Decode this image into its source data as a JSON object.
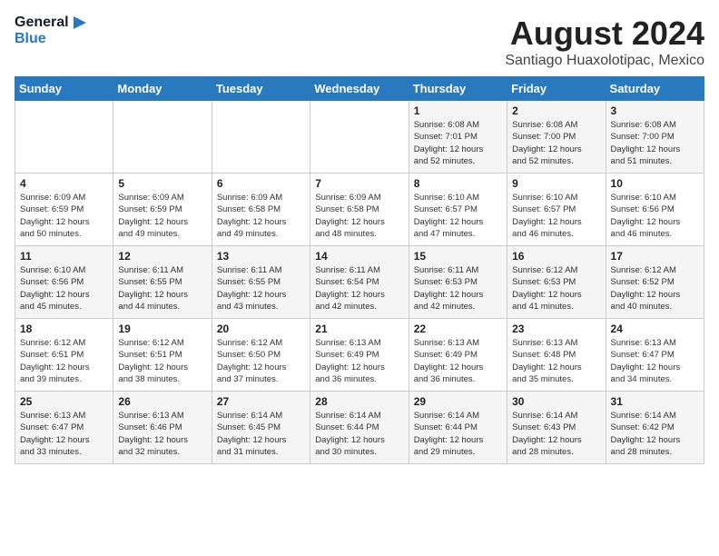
{
  "header": {
    "logo_line1": "General",
    "logo_line2": "Blue",
    "month": "August 2024",
    "location": "Santiago Huaxolotipac, Mexico"
  },
  "weekdays": [
    "Sunday",
    "Monday",
    "Tuesday",
    "Wednesday",
    "Thursday",
    "Friday",
    "Saturday"
  ],
  "weeks": [
    [
      {
        "day": "",
        "info": ""
      },
      {
        "day": "",
        "info": ""
      },
      {
        "day": "",
        "info": ""
      },
      {
        "day": "",
        "info": ""
      },
      {
        "day": "1",
        "info": "Sunrise: 6:08 AM\nSunset: 7:01 PM\nDaylight: 12 hours\nand 52 minutes."
      },
      {
        "day": "2",
        "info": "Sunrise: 6:08 AM\nSunset: 7:00 PM\nDaylight: 12 hours\nand 52 minutes."
      },
      {
        "day": "3",
        "info": "Sunrise: 6:08 AM\nSunset: 7:00 PM\nDaylight: 12 hours\nand 51 minutes."
      }
    ],
    [
      {
        "day": "4",
        "info": "Sunrise: 6:09 AM\nSunset: 6:59 PM\nDaylight: 12 hours\nand 50 minutes."
      },
      {
        "day": "5",
        "info": "Sunrise: 6:09 AM\nSunset: 6:59 PM\nDaylight: 12 hours\nand 49 minutes."
      },
      {
        "day": "6",
        "info": "Sunrise: 6:09 AM\nSunset: 6:58 PM\nDaylight: 12 hours\nand 49 minutes."
      },
      {
        "day": "7",
        "info": "Sunrise: 6:09 AM\nSunset: 6:58 PM\nDaylight: 12 hours\nand 48 minutes."
      },
      {
        "day": "8",
        "info": "Sunrise: 6:10 AM\nSunset: 6:57 PM\nDaylight: 12 hours\nand 47 minutes."
      },
      {
        "day": "9",
        "info": "Sunrise: 6:10 AM\nSunset: 6:57 PM\nDaylight: 12 hours\nand 46 minutes."
      },
      {
        "day": "10",
        "info": "Sunrise: 6:10 AM\nSunset: 6:56 PM\nDaylight: 12 hours\nand 46 minutes."
      }
    ],
    [
      {
        "day": "11",
        "info": "Sunrise: 6:10 AM\nSunset: 6:56 PM\nDaylight: 12 hours\nand 45 minutes."
      },
      {
        "day": "12",
        "info": "Sunrise: 6:11 AM\nSunset: 6:55 PM\nDaylight: 12 hours\nand 44 minutes."
      },
      {
        "day": "13",
        "info": "Sunrise: 6:11 AM\nSunset: 6:55 PM\nDaylight: 12 hours\nand 43 minutes."
      },
      {
        "day": "14",
        "info": "Sunrise: 6:11 AM\nSunset: 6:54 PM\nDaylight: 12 hours\nand 42 minutes."
      },
      {
        "day": "15",
        "info": "Sunrise: 6:11 AM\nSunset: 6:53 PM\nDaylight: 12 hours\nand 42 minutes."
      },
      {
        "day": "16",
        "info": "Sunrise: 6:12 AM\nSunset: 6:53 PM\nDaylight: 12 hours\nand 41 minutes."
      },
      {
        "day": "17",
        "info": "Sunrise: 6:12 AM\nSunset: 6:52 PM\nDaylight: 12 hours\nand 40 minutes."
      }
    ],
    [
      {
        "day": "18",
        "info": "Sunrise: 6:12 AM\nSunset: 6:51 PM\nDaylight: 12 hours\nand 39 minutes."
      },
      {
        "day": "19",
        "info": "Sunrise: 6:12 AM\nSunset: 6:51 PM\nDaylight: 12 hours\nand 38 minutes."
      },
      {
        "day": "20",
        "info": "Sunrise: 6:12 AM\nSunset: 6:50 PM\nDaylight: 12 hours\nand 37 minutes."
      },
      {
        "day": "21",
        "info": "Sunrise: 6:13 AM\nSunset: 6:49 PM\nDaylight: 12 hours\nand 36 minutes."
      },
      {
        "day": "22",
        "info": "Sunrise: 6:13 AM\nSunset: 6:49 PM\nDaylight: 12 hours\nand 36 minutes."
      },
      {
        "day": "23",
        "info": "Sunrise: 6:13 AM\nSunset: 6:48 PM\nDaylight: 12 hours\nand 35 minutes."
      },
      {
        "day": "24",
        "info": "Sunrise: 6:13 AM\nSunset: 6:47 PM\nDaylight: 12 hours\nand 34 minutes."
      }
    ],
    [
      {
        "day": "25",
        "info": "Sunrise: 6:13 AM\nSunset: 6:47 PM\nDaylight: 12 hours\nand 33 minutes."
      },
      {
        "day": "26",
        "info": "Sunrise: 6:13 AM\nSunset: 6:46 PM\nDaylight: 12 hours\nand 32 minutes."
      },
      {
        "day": "27",
        "info": "Sunrise: 6:14 AM\nSunset: 6:45 PM\nDaylight: 12 hours\nand 31 minutes."
      },
      {
        "day": "28",
        "info": "Sunrise: 6:14 AM\nSunset: 6:44 PM\nDaylight: 12 hours\nand 30 minutes."
      },
      {
        "day": "29",
        "info": "Sunrise: 6:14 AM\nSunset: 6:44 PM\nDaylight: 12 hours\nand 29 minutes."
      },
      {
        "day": "30",
        "info": "Sunrise: 6:14 AM\nSunset: 6:43 PM\nDaylight: 12 hours\nand 28 minutes."
      },
      {
        "day": "31",
        "info": "Sunrise: 6:14 AM\nSunset: 6:42 PM\nDaylight: 12 hours\nand 28 minutes."
      }
    ]
  ]
}
